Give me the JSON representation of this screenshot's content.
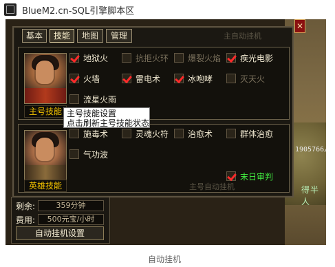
{
  "window": {
    "title": "BlueM2.cn-SQL引擎脚本区"
  },
  "tabs": [
    {
      "label": "基本"
    },
    {
      "label": "技能"
    },
    {
      "label": "地图"
    },
    {
      "label": "管理"
    }
  ],
  "top_faint_text": "主自动挂机",
  "main_hero": {
    "label": "主号技能",
    "skills": [
      {
        "label": "地狱火",
        "checked": true,
        "dim": false
      },
      {
        "label": "抗拒火环",
        "checked": false,
        "dim": true
      },
      {
        "label": "爆裂火焰",
        "checked": false,
        "dim": true
      },
      {
        "label": "疾光电影",
        "checked": true,
        "dim": false
      },
      {
        "label": "火墙",
        "checked": true,
        "dim": false
      },
      {
        "label": "雷电术",
        "checked": true,
        "dim": false
      },
      {
        "label": "冰咆哮",
        "checked": true,
        "dim": false
      },
      {
        "label": "灭天火",
        "checked": false,
        "dim": true
      },
      {
        "label": "流星火雨",
        "checked": false,
        "dim": false
      }
    ]
  },
  "tooltip": {
    "line1": "主号技能设置",
    "line2": "点击刷新主号技能状态"
  },
  "hero": {
    "label": "英雄技能",
    "skills": [
      {
        "label": "施毒术",
        "checked": false,
        "dim": false
      },
      {
        "label": "灵魂火符",
        "checked": false,
        "dim": false
      },
      {
        "label": "治愈术",
        "checked": false,
        "dim": false
      },
      {
        "label": "群体治愈",
        "checked": false,
        "dim": false
      },
      {
        "label": "气功波",
        "checked": false,
        "dim": false
      }
    ],
    "special": {
      "label": "末日审判",
      "checked": true
    }
  },
  "bottom_faint_text": "主号自动挂机",
  "footer": {
    "remaining_label": "剩余:",
    "remaining_value": "359分钟",
    "cost_label": "费用:",
    "cost_value": "500元宝/小时",
    "button_label": "自动挂机设置"
  },
  "map": {
    "number": "1905766/",
    "green_text": "得半人",
    "close_glyph": "✕"
  },
  "caption": "自动挂机",
  "colors": {
    "panel_bg": "#1b1812",
    "accent_gold": "#f0c000",
    "check_red": "#ff2a2a",
    "green": "#43f243"
  }
}
